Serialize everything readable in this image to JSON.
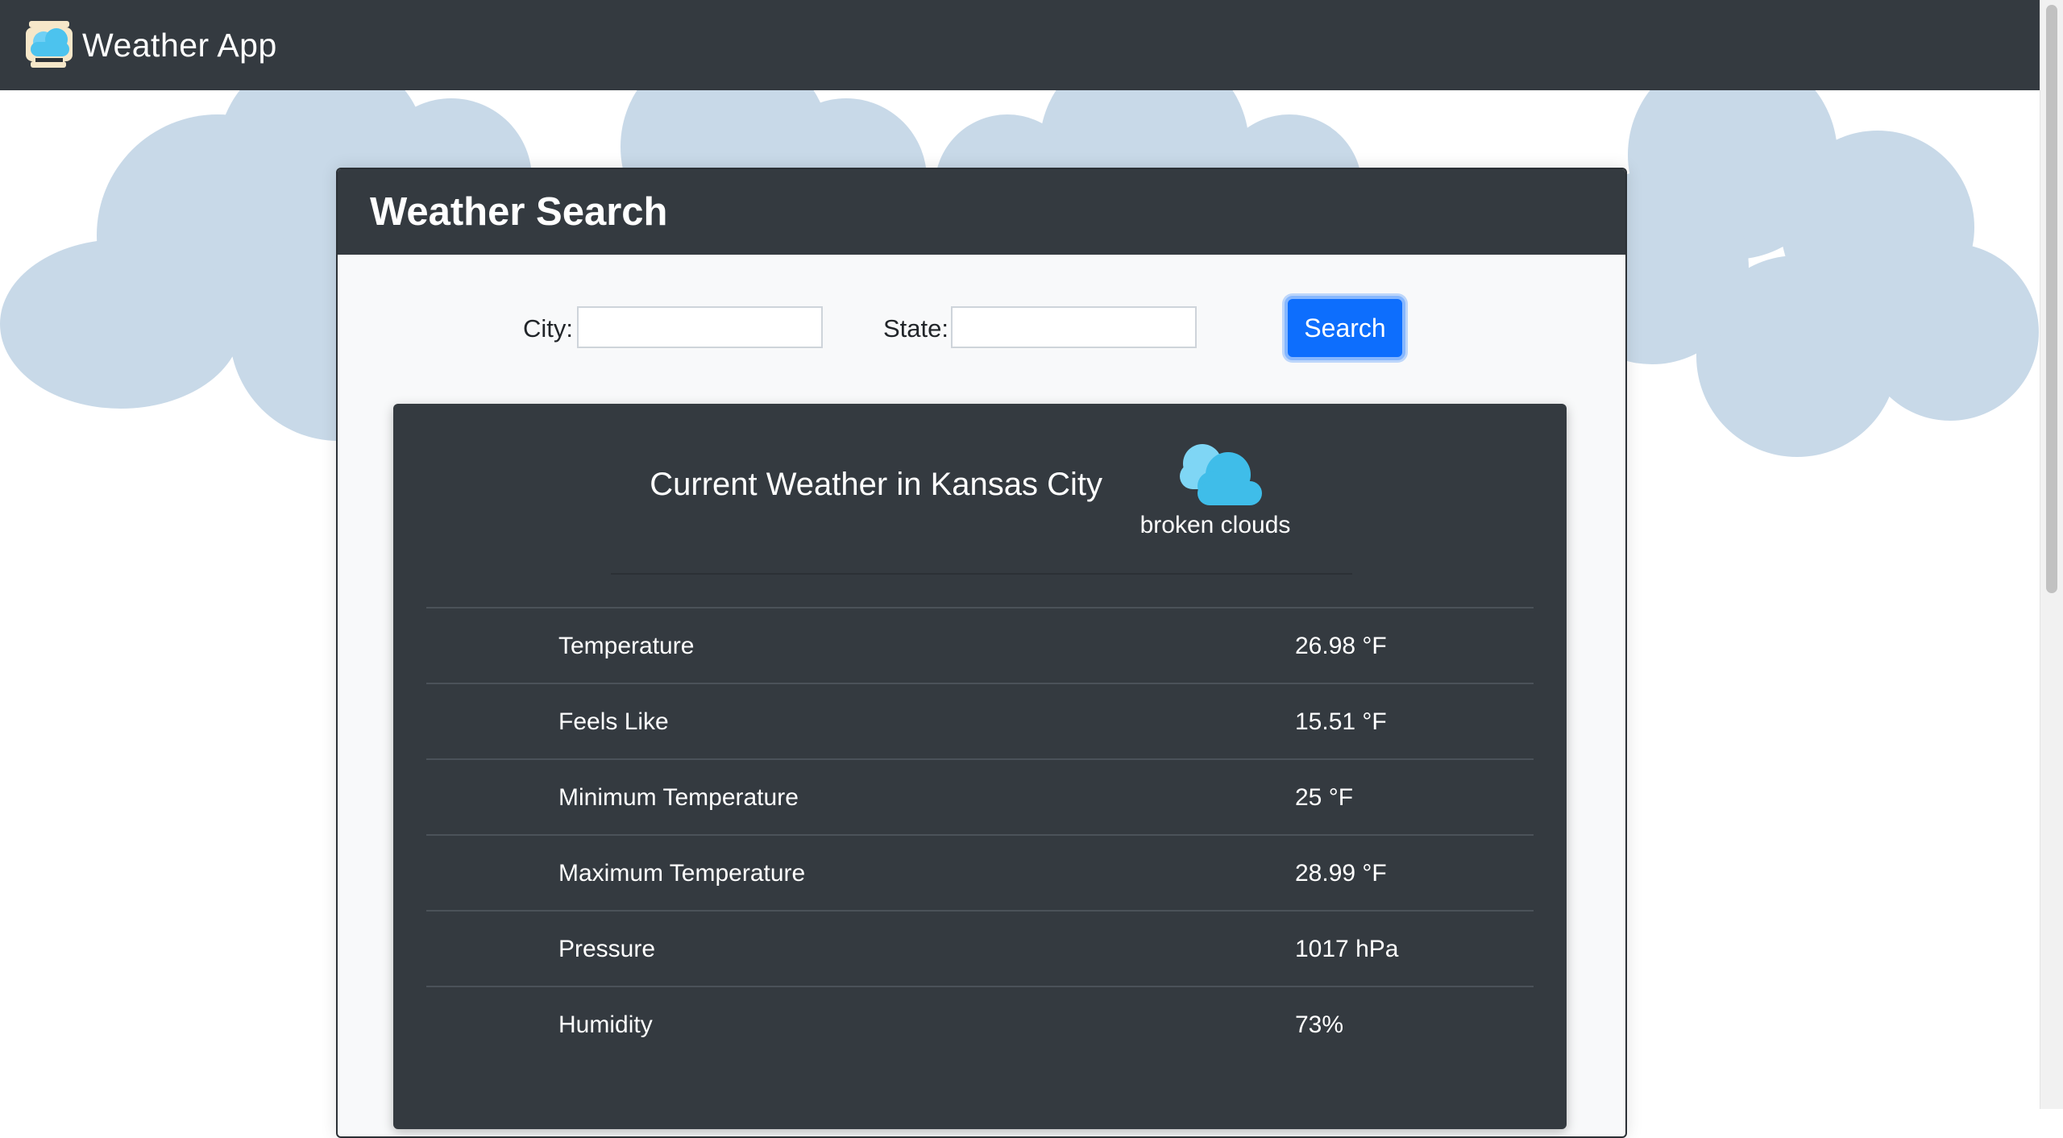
{
  "navbar": {
    "brand": "Weather App",
    "brand_icon": "cloud-logo-icon"
  },
  "search": {
    "title": "Weather Search",
    "city_label": "City:",
    "city_value": "",
    "state_label": "State:",
    "state_value": "",
    "button_label": "Search"
  },
  "current": {
    "title": "Current Weather in Kansas City",
    "icon": "broken-clouds-icon",
    "description": "broken clouds",
    "rows": [
      {
        "label": "Temperature",
        "value": "26.98 °F"
      },
      {
        "label": "Feels Like",
        "value": "15.51 °F"
      },
      {
        "label": "Minimum Temperature",
        "value": "25 °F"
      },
      {
        "label": "Maximum Temperature",
        "value": "28.99 °F"
      },
      {
        "label": "Pressure",
        "value": "1017 hPa"
      },
      {
        "label": "Humidity",
        "value": "73%"
      }
    ]
  },
  "colors": {
    "navbar": "#343a40",
    "primary": "#0d6efd",
    "cloud": "#c8d9e8",
    "icon_cloud": "#4cc3ee"
  }
}
